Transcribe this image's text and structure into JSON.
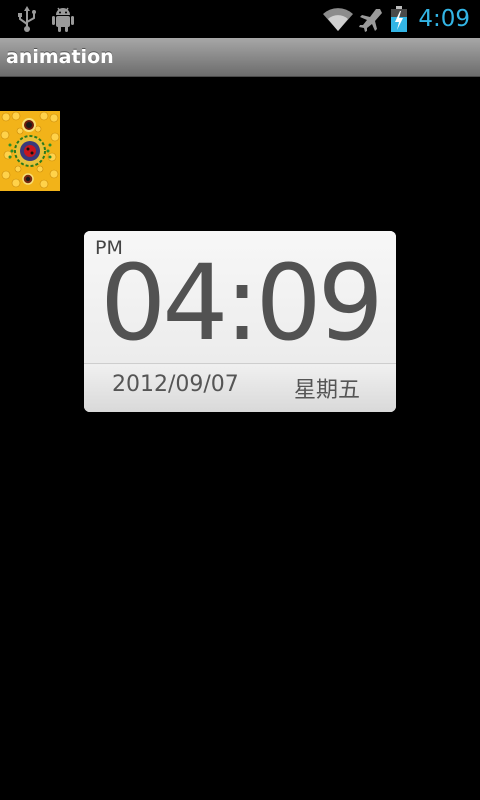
{
  "status_bar": {
    "time": "4:09",
    "left_icons": [
      "usb-icon",
      "android-debug-icon"
    ],
    "right_icons": [
      "wifi-icon",
      "airplane-mode-icon",
      "battery-charging-icon"
    ],
    "accent_color": "#33b5e5"
  },
  "app": {
    "title": "animation"
  },
  "image_tile": {
    "icon": "ladybug-honeycomb-image"
  },
  "clock": {
    "ampm": "PM",
    "time": "04:09",
    "date": "2012/09/07",
    "weekday": "星期五"
  }
}
